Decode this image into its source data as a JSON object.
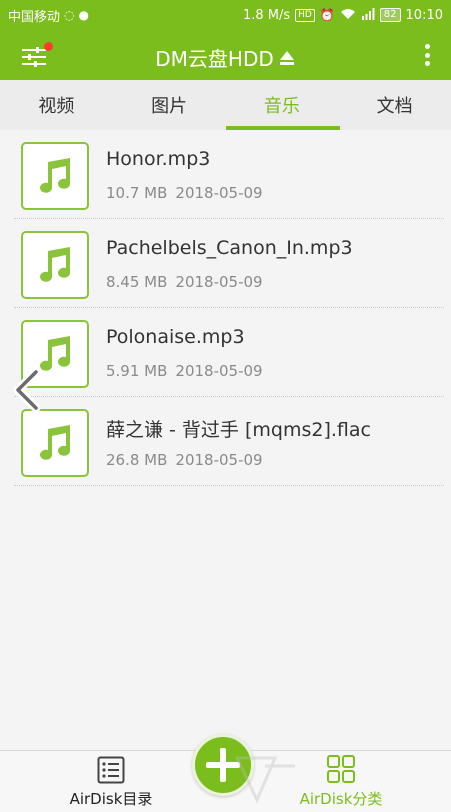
{
  "status_bar": {
    "carrier": "中国移动",
    "speed": "1.8 M/s",
    "hd_badge": "HD",
    "battery": "82",
    "time": "10:10"
  },
  "app_bar": {
    "title": "DM云盘HDD",
    "accent_color": "#7cbd1e",
    "notification_dot_color": "#ff3b30"
  },
  "tabs": [
    {
      "label": "视频",
      "active": false
    },
    {
      "label": "图片",
      "active": false
    },
    {
      "label": "音乐",
      "active": true
    },
    {
      "label": "文档",
      "active": false
    }
  ],
  "files": [
    {
      "name": "Honor.mp3",
      "size": "10.7 MB",
      "date": "2018-05-09",
      "icon": "music-note-icon"
    },
    {
      "name": "Pachelbels_Canon_In.mp3",
      "size": "8.45 MB",
      "date": "2018-05-09",
      "icon": "music-note-icon"
    },
    {
      "name": "Polonaise.mp3",
      "size": "5.91 MB",
      "date": "2018-05-09",
      "icon": "music-note-icon"
    },
    {
      "name": "薛之谦 - 背过手 [mqms2].flac",
      "size": "26.8 MB",
      "date": "2018-05-09",
      "icon": "music-note-icon"
    }
  ],
  "bottom_nav": {
    "left_label": "AirDisk目录",
    "right_label": "AirDisk分类",
    "active": "right"
  }
}
